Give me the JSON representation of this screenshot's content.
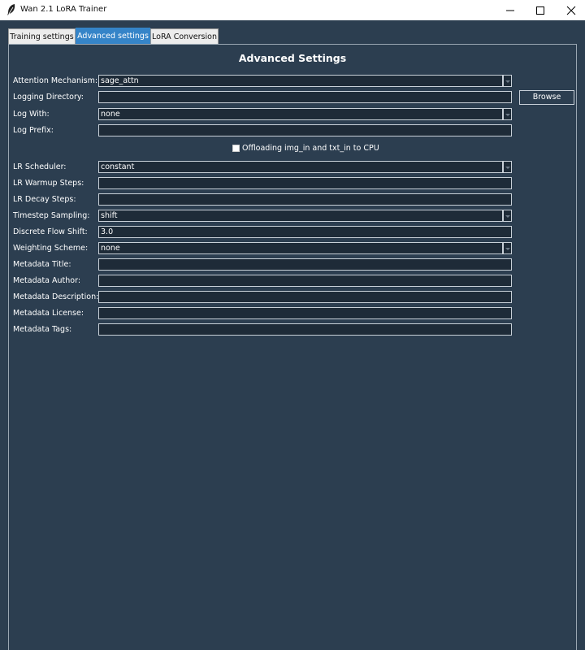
{
  "window": {
    "title": "Wan 2.1 LoRA Trainer",
    "icon": "feather-icon"
  },
  "tabs": [
    {
      "label": "Training settings"
    },
    {
      "label": "Advanced settings",
      "active": true
    },
    {
      "label": "LoRA Conversion"
    }
  ],
  "panel": {
    "heading": "Advanced Settings"
  },
  "fields": {
    "attention_mechanism": {
      "label": "Attention Mechanism:",
      "value": "sage_attn"
    },
    "logging_directory": {
      "label": "Logging Directory:",
      "value": ""
    },
    "browse_button": "Browse",
    "log_with": {
      "label": "Log With:",
      "value": "none"
    },
    "log_prefix": {
      "label": "Log Prefix:",
      "value": ""
    },
    "offload_checkbox": {
      "label": "Offloading img_in and txt_in to CPU",
      "checked": false
    },
    "lr_scheduler": {
      "label": "LR Scheduler:",
      "value": "constant"
    },
    "lr_warmup_steps": {
      "label": "LR Warmup Steps:",
      "value": ""
    },
    "lr_decay_steps": {
      "label": "LR Decay Steps:",
      "value": ""
    },
    "timestep_sampling": {
      "label": "Timestep Sampling:",
      "value": "shift"
    },
    "discrete_flow_shift": {
      "label": "Discrete Flow Shift:",
      "value": "3.0"
    },
    "weighting_scheme": {
      "label": "Weighting Scheme:",
      "value": "none"
    },
    "metadata_title": {
      "label": "Metadata Title:",
      "value": ""
    },
    "metadata_author": {
      "label": "Metadata Author:",
      "value": ""
    },
    "metadata_description": {
      "label": "Metadata Description:",
      "value": ""
    },
    "metadata_license": {
      "label": "Metadata License:",
      "value": ""
    },
    "metadata_tags": {
      "label": "Metadata Tags:",
      "value": ""
    }
  },
  "colors": {
    "background": "#2c3e50",
    "active_tab": "#3584c8",
    "field_bg": "#1e2b38"
  }
}
